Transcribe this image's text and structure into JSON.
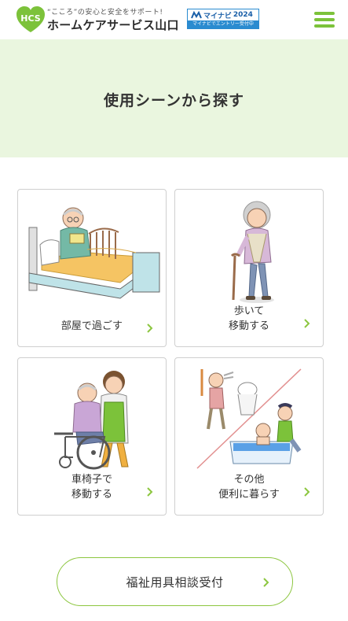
{
  "header": {
    "logo_text": "HCS",
    "tagline": "“こころ”の安心と安全をサポート!",
    "company": "ホームケアサービス山口",
    "mynavi": {
      "brand": "マイナビ",
      "year": "2024",
      "sub": "マイナビでエントリー受付中"
    },
    "menu_icon": "hamburger-menu-icon"
  },
  "hero": {
    "title": "使用シーンから探す"
  },
  "cards": [
    {
      "lines": [
        "部屋で過ごす"
      ],
      "icon": "bed-scene-illustration"
    },
    {
      "lines": [
        "歩いて",
        "移動する"
      ],
      "icon": "walking-cane-illustration"
    },
    {
      "lines": [
        "車椅子で",
        "移動する"
      ],
      "icon": "wheelchair-illustration"
    },
    {
      "lines": [
        "その他",
        "便利に暮らす"
      ],
      "icon": "bath-toilet-illustration"
    }
  ],
  "cta": {
    "label": "福祉用具相談受付",
    "icon": "chevron-right-icon"
  },
  "colors": {
    "accent_green": "#8cc63f",
    "hero_bg": "#eaf6df",
    "mynavi_blue": "#2a8bd0"
  }
}
